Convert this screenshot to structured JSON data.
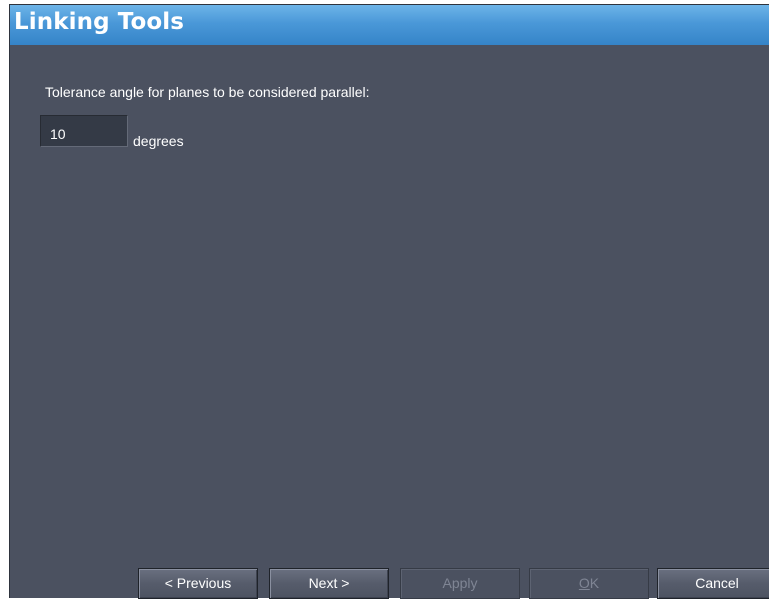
{
  "window": {
    "title": "Linking Tools"
  },
  "form": {
    "prompt": "Tolerance angle for planes to be considered parallel:",
    "tolerance_value": "10",
    "unit": "degrees"
  },
  "buttons": {
    "previous": "< Previous",
    "next": "Next >",
    "apply": "Apply",
    "ok_mnemonic": "O",
    "ok_rest": "K",
    "cancel": "Cancel"
  },
  "colors": {
    "title_bar": "#4a98d8",
    "panel_background": "#4b5160"
  }
}
